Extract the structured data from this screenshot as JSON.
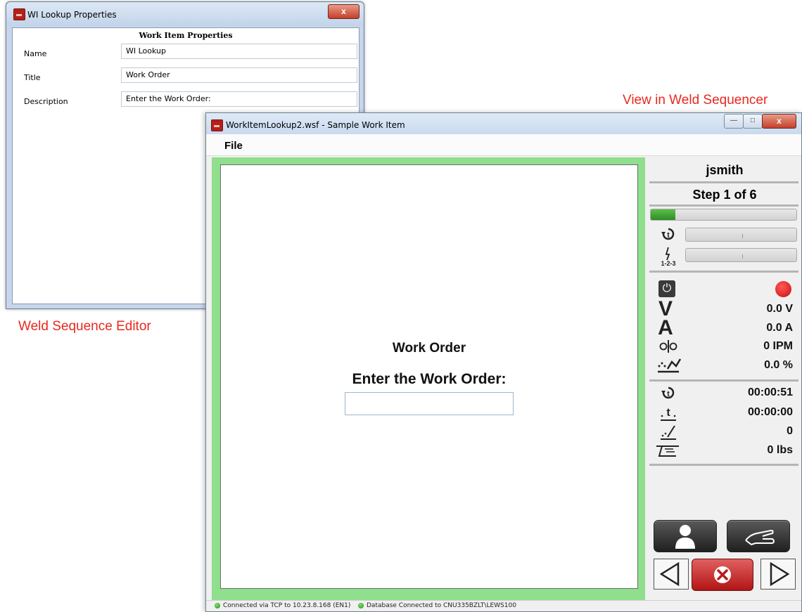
{
  "editor": {
    "window_title": "WI Lookup Properties",
    "close_glyph": "x",
    "section_header": "Work Item Properties",
    "fields": [
      {
        "label": "Name",
        "value": "WI Lookup"
      },
      {
        "label": "Title",
        "value": "Work Order"
      },
      {
        "label": "Description",
        "value": "Enter the Work Order:"
      }
    ],
    "caption": "Weld Sequence Editor"
  },
  "sequencer": {
    "caption": "View in Weld Sequencer",
    "window_title": "WorkItemLookup2.wsf - Sample Work Item",
    "menu": {
      "file": "File"
    },
    "work_item": {
      "title": "Work Order",
      "prompt": "Enter the Work Order:",
      "input_value": ""
    },
    "side": {
      "user": "jsmith",
      "step": "Step 1 of 6",
      "step_progress_fraction": 0.17,
      "sequence_label": "1-2-3",
      "voltage": "0.0 V",
      "current": "0.0 A",
      "wire_feed": "0 IPM",
      "percent": "0.0 %",
      "arc_time": "00:00:51",
      "weld_time": "00:00:00",
      "weld_count": "0",
      "wire_used": "0 lbs"
    },
    "status": {
      "connection": "Connected via TCP to 10.23.8.168 (EN1)",
      "database": "Database Connected to CNU335BZLT\\LEWS100"
    },
    "colors": {
      "frame_green": "#8fdf8d",
      "caption_red": "#e8281f",
      "record_red": "#c90d0d"
    },
    "icons": [
      "timer-icon",
      "sequence-icon",
      "power-icon",
      "record-indicator-icon",
      "voltage-icon",
      "amperage-icon",
      "wire-feed-icon",
      "trim-icon",
      "arc-time-icon",
      "weld-time-icon",
      "weld-count-icon",
      "wire-spool-icon",
      "user-icon",
      "hand-icon",
      "previous-icon",
      "cancel-icon",
      "next-icon"
    ]
  }
}
